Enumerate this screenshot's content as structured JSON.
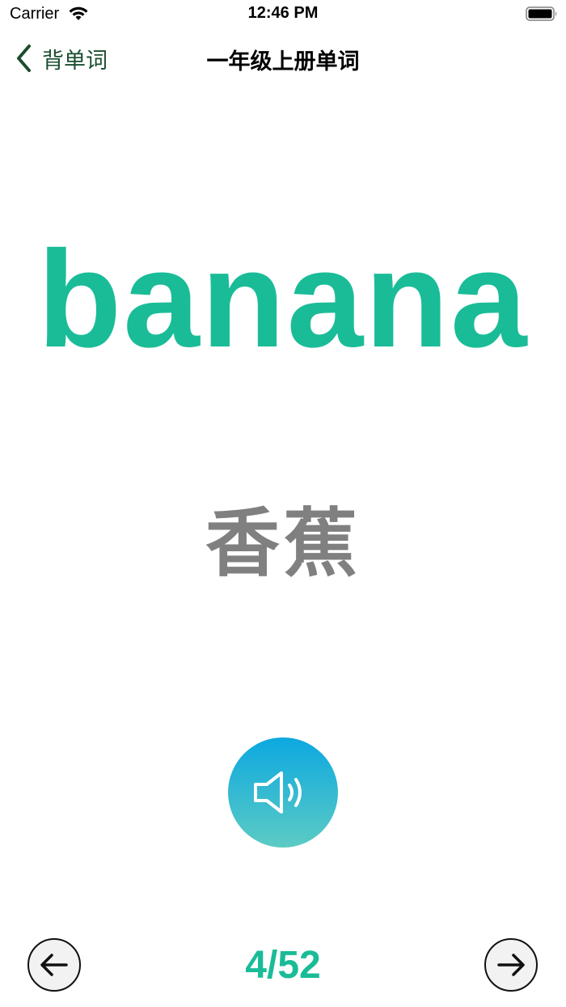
{
  "status_bar": {
    "carrier": "Carrier",
    "time": "12:46 PM",
    "icons": [
      "wifi-icon",
      "battery-icon"
    ]
  },
  "nav": {
    "back_label": "背单词",
    "title": "一年级上册单词"
  },
  "card": {
    "english": "banana",
    "chinese": "香蕉"
  },
  "controls": {
    "speaker_icon": "speaker-icon",
    "prev_icon": "arrow-left-icon",
    "next_icon": "arrow-right-icon"
  },
  "progress": {
    "text": "4/52",
    "current": 4,
    "total": 52
  },
  "colors": {
    "accent": "#1abc98",
    "nav_back": "#1a4d2e",
    "chinese_text": "#808080",
    "speaker_gradient_top": "#0ca8e0",
    "speaker_gradient_bottom": "#5ccbc4"
  }
}
